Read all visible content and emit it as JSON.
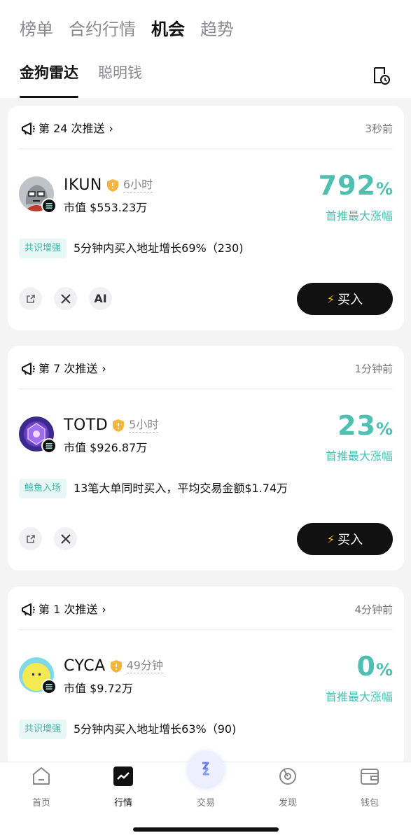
{
  "header": {
    "main_tabs": [
      {
        "label": "榜单"
      },
      {
        "label": "合约行情"
      },
      {
        "label": "机会"
      },
      {
        "label": "趋势"
      }
    ],
    "sub_tabs": [
      {
        "label": "金狗雷达"
      },
      {
        "label": "聪明钱"
      }
    ]
  },
  "cards": [
    {
      "push": "第 24 次推送",
      "time": "3秒前",
      "token": "IKUN",
      "age": "6小时",
      "mcap": "市值 $553.23万",
      "gain_num": "792",
      "gain_pct": "%",
      "gain_label": "首推最大涨幅",
      "tag": "共识增强",
      "tag_desc": "5分钟内买入地址增长69%（230)",
      "ai_label": "AI",
      "buy_label": "买入"
    },
    {
      "push": "第 7 次推送",
      "time": "1分钟前",
      "token": "TOTD",
      "age": "5小时",
      "mcap": "市值 $926.87万",
      "gain_num": "23",
      "gain_pct": "%",
      "gain_label": "首推最大涨幅",
      "tag": "鲸鱼入场",
      "tag_desc": "13笔大单同时买入，平均交易金额$1.74万",
      "buy_label": "买入"
    },
    {
      "push": "第 1 次推送",
      "time": "4分钟前",
      "token": "CYCA",
      "age": "49分钟",
      "mcap": "市值 $9.72万",
      "gain_num": "0",
      "gain_pct": "%",
      "gain_label": "首推最大涨幅",
      "tag": "共识增强",
      "tag_desc": "5分钟内买入地址增长63%（90)"
    }
  ],
  "bottom_nav": [
    {
      "label": "首页",
      "icon": "home-icon"
    },
    {
      "label": "行情",
      "icon": "market-chart-icon"
    },
    {
      "label": "交易",
      "icon": "trade-swap-icon"
    },
    {
      "label": "发现",
      "icon": "discover-icon"
    },
    {
      "label": "钱包",
      "icon": "wallet-icon"
    }
  ],
  "colors": {
    "accent": "#4fbfb2",
    "tag_bg": "#e7f7f5",
    "button": "#111111",
    "bolt": "#f5b822"
  }
}
